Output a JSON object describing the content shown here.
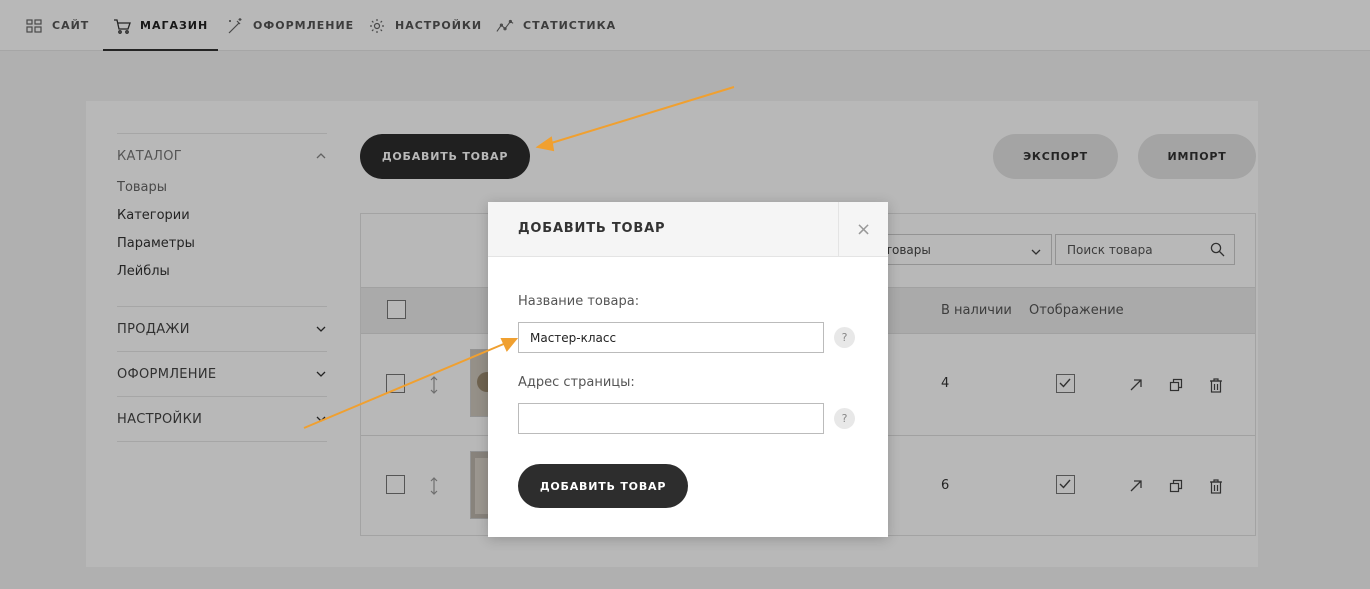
{
  "topnav": {
    "items": [
      {
        "label": "САЙТ",
        "icon": "grid-icon"
      },
      {
        "label": "МАГАЗИН",
        "icon": "cart-icon",
        "active": true
      },
      {
        "label": "ОФОРМЛЕНИЕ",
        "icon": "magic-wand-icon"
      },
      {
        "label": "НАСТРОЙКИ",
        "icon": "gear-icon"
      },
      {
        "label": "СТАТИСТИКА",
        "icon": "chart-line-icon"
      }
    ]
  },
  "sidebar": {
    "catalog": {
      "title": "КАТАЛОГ",
      "items": [
        "Товары",
        "Категории",
        "Параметры",
        "Лейблы"
      ]
    },
    "sections": [
      "ПРОДАЖИ",
      "ОФОРМЛЕНИЕ",
      "НАСТРОЙКИ"
    ]
  },
  "toolbar": {
    "add_product": "ДОБАВИТЬ ТОВАР",
    "export": "ЭКСПОРТ",
    "import": "ИМПОРТ"
  },
  "filters": {
    "category_select_value": "товары",
    "search_placeholder": "Поиск товара"
  },
  "table": {
    "headers": {
      "in_stock": "В наличии",
      "display": "Отображение"
    },
    "rows": [
      {
        "in_stock": "4",
        "displayed": true
      },
      {
        "in_stock": "6",
        "displayed": true
      }
    ]
  },
  "modal": {
    "title": "ДОБАВИТЬ ТОВАР",
    "close": "×",
    "name_label": "Название товара:",
    "name_value": "Мастер-класс",
    "url_label": "Адрес страницы:",
    "url_value": "",
    "help": "?",
    "submit": "ДОБАВИТЬ ТОВАР"
  },
  "colors": {
    "dark_button": "#2d2d2d",
    "annotation_arrow": "#f0a030"
  }
}
